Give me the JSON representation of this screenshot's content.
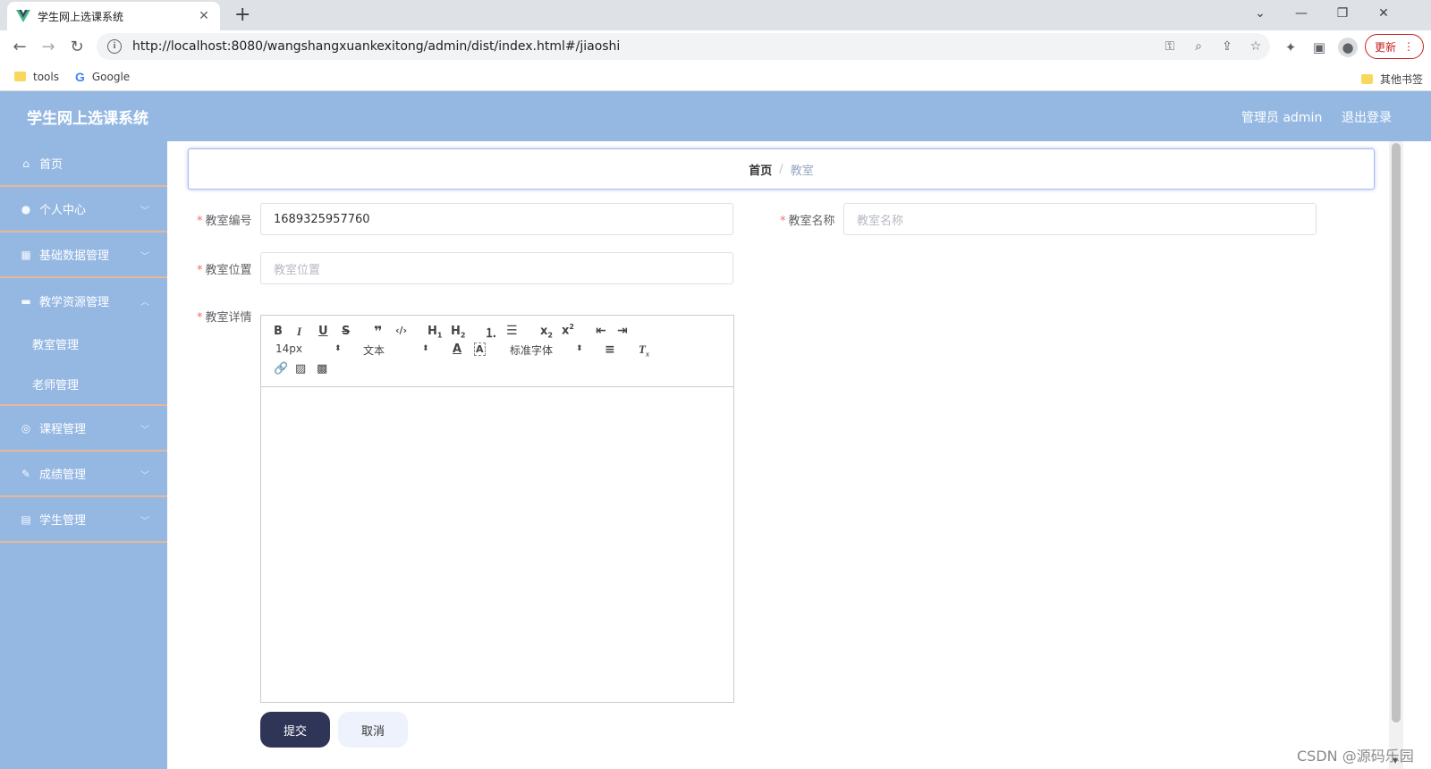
{
  "browser": {
    "tab_title": "学生网上选课系统",
    "url": "http://localhost:8080/wangshangxuankexitong/admin/dist/index.html#/jiaoshi",
    "update_label": "更新",
    "bookmarks": [
      {
        "label": "tools"
      },
      {
        "label": "Google"
      }
    ],
    "other_bookmarks": "其他书签"
  },
  "header": {
    "title": "学生网上选课系统",
    "user": "管理员 admin",
    "logout": "退出登录"
  },
  "sidebar": {
    "items": [
      {
        "label": "首页",
        "icon": "home-icon"
      },
      {
        "label": "个人中心",
        "icon": "user-icon"
      },
      {
        "label": "基础数据管理",
        "icon": "data-icon"
      },
      {
        "label": "教学资源管理",
        "icon": "briefcase-icon"
      },
      {
        "label": "课程管理",
        "icon": "compass-icon"
      },
      {
        "label": "成绩管理",
        "icon": "edit-icon"
      },
      {
        "label": "学生管理",
        "icon": "clipboard-icon"
      }
    ],
    "submenu": [
      {
        "label": "教室管理"
      },
      {
        "label": "老师管理"
      }
    ]
  },
  "breadcrumb": {
    "home": "首页",
    "separator": "/",
    "current": "教室"
  },
  "form": {
    "room_no_label": "教室编号",
    "room_no_value": "1689325957760",
    "room_name_label": "教室名称",
    "room_name_placeholder": "教室名称",
    "room_location_label": "教室位置",
    "room_location_placeholder": "教室位置",
    "room_detail_label": "教室详情",
    "editor": {
      "font_size": "14px",
      "heading": "文本",
      "font_family": "标准字体"
    },
    "submit_label": "提交",
    "cancel_label": "取消"
  },
  "watermark": "CSDN @源码乐园",
  "colors": {
    "header_bg": "#95b8e3",
    "sidebar_bg": "#95b8e3",
    "menu_divider": "#e7b796",
    "submit_bg": "#2f3557",
    "cancel_bg": "#edf2fc",
    "required": "#f56c6c"
  }
}
